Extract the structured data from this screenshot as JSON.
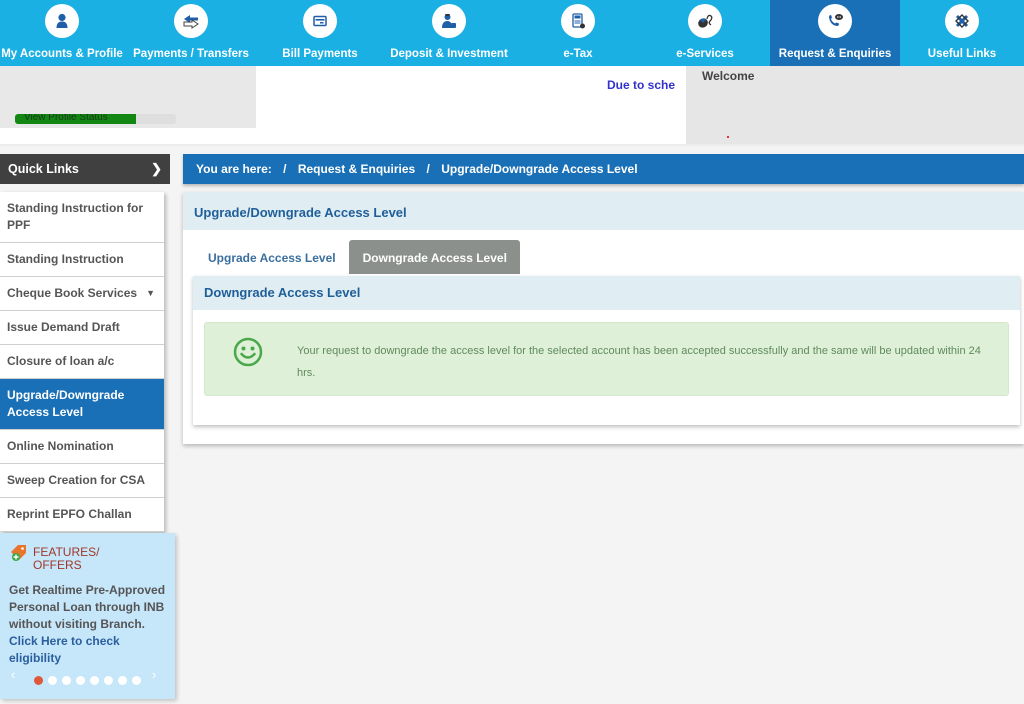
{
  "topnav": {
    "items": [
      {
        "label": "My Accounts & Profile",
        "icon": "user-icon",
        "active": false
      },
      {
        "label": "Payments / Transfers",
        "icon": "transfer-icon",
        "active": false
      },
      {
        "label": "Bill Payments",
        "icon": "bill-icon",
        "active": false
      },
      {
        "label": "Deposit & Investment",
        "icon": "investment-icon",
        "active": false
      },
      {
        "label": "e-Tax",
        "icon": "tax-document-icon",
        "active": false
      },
      {
        "label": "e-Services",
        "icon": "mouse-icon",
        "active": false
      },
      {
        "label": "Request & Enquiries",
        "icon": "phone-chat-icon",
        "active": true
      },
      {
        "label": "Useful Links",
        "icon": "links-icon",
        "active": false
      }
    ]
  },
  "header": {
    "profile_status_label": "View Profile Status",
    "profile_progress_percent": 75,
    "marquee_text": "Due to sche",
    "welcome_label": "Welcome"
  },
  "sidebar": {
    "quick_links_label": "Quick Links",
    "quick_links_icon": "chevron-right-icon",
    "items": [
      {
        "label": "Standing Instruction for PPF",
        "active": false,
        "has_dropdown": false
      },
      {
        "label": "Standing Instruction",
        "active": false,
        "has_dropdown": false
      },
      {
        "label": "Cheque Book Services",
        "active": false,
        "has_dropdown": true
      },
      {
        "label": "Issue Demand Draft",
        "active": false,
        "has_dropdown": false
      },
      {
        "label": "Closure of loan a/c",
        "active": false,
        "has_dropdown": false
      },
      {
        "label": "Upgrade/Downgrade Access Level",
        "active": true,
        "has_dropdown": false
      },
      {
        "label": "Online Nomination",
        "active": false,
        "has_dropdown": false
      },
      {
        "label": "Sweep Creation for CSA",
        "active": false,
        "has_dropdown": false
      },
      {
        "label": "Reprint EPFO Challan",
        "active": false,
        "has_dropdown": false
      }
    ],
    "offers": {
      "title_line1": "FEATURES/",
      "title_line2": "OFFERS",
      "text": "Get Realtime Pre-Approved Personal Loan through INB without visiting Branch.",
      "link_text": "Click Here to check eligibility",
      "prev_label": "‹",
      "next_label": "›",
      "slide_count": 8,
      "active_slide": 1
    }
  },
  "breadcrumb": {
    "prefix": "You are here:",
    "separator": "/",
    "items": [
      "Request & Enquiries",
      "Upgrade/Downgrade Access Level"
    ]
  },
  "main": {
    "title": "Upgrade/Downgrade Access Level",
    "tabs": [
      {
        "label": "Upgrade Access Level",
        "active": false
      },
      {
        "label": "Downgrade Access Level",
        "active": true
      }
    ],
    "panel_title": "Downgrade Access Level",
    "alert": {
      "type": "success",
      "icon": "smiley-icon",
      "message": "Your request to downgrade the access level for the selected account has been accepted successfully and the same will be updated within 24 hrs."
    }
  },
  "colors": {
    "nav_bg": "#1bb0e4",
    "nav_active": "#1a70b6",
    "breadcrumb_bg": "#1a70b6",
    "quick_links_bg": "#404040",
    "success_bg": "#dff0d8",
    "progress_fill": "#128812",
    "offer_dot_active": "#e0583a"
  }
}
